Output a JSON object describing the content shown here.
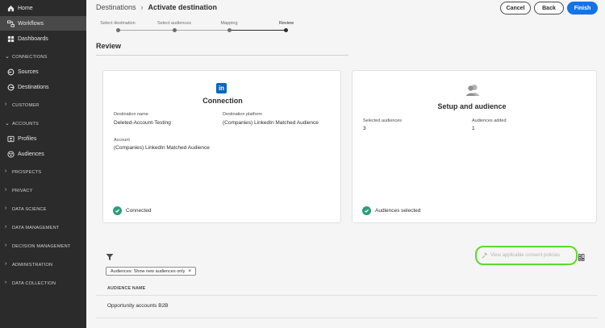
{
  "sidebar": {
    "top_items": [
      {
        "label": "Home",
        "icon": "home-icon"
      },
      {
        "label": "Workflows",
        "icon": "workflows-icon"
      },
      {
        "label": "Dashboards",
        "icon": "dashboards-icon"
      }
    ],
    "sections": {
      "connections": "CONNECTIONS",
      "customer": "CUSTOMER",
      "accounts": "ACCOUNTS",
      "prospects": "PROSPECTS",
      "privacy": "PRIVACY",
      "data_science": "DATA SCIENCE",
      "data_management": "DATA MANAGEMENT",
      "decision_management": "DECISION MANAGEMENT",
      "administration": "ADMINISTRATION",
      "data_collection": "DATA COLLECTION"
    },
    "connections_items": [
      {
        "label": "Sources",
        "icon": "sources-icon"
      },
      {
        "label": "Destinations",
        "icon": "destinations-icon"
      }
    ],
    "accounts_items": [
      {
        "label": "Profiles",
        "icon": "profiles-icon"
      },
      {
        "label": "Audiences",
        "icon": "audiences-icon"
      }
    ]
  },
  "header": {
    "breadcrumb_parent": "Destinations",
    "breadcrumb_separator": "›",
    "breadcrumb_current": "Activate destination",
    "cancel_label": "Cancel",
    "back_label": "Back",
    "finish_label": "Finish"
  },
  "steps": [
    {
      "label": "Select destination"
    },
    {
      "label": "Select audiences"
    },
    {
      "label": "Mapping"
    },
    {
      "label": "Review"
    }
  ],
  "review_title": "Review",
  "connection_card": {
    "logo_text": "in",
    "title": "Connection",
    "destination_name_label": "Destination name",
    "destination_name_value": "Deleted-Account-Testing",
    "destination_platform_label": "Destination platform",
    "destination_platform_value": "(Companies) LinkedIn Matched Audience",
    "account_label": "Account",
    "account_value": "(Companies) LinkedIn Matched Audience",
    "status": "Connected"
  },
  "setup_card": {
    "title": "Setup and audience",
    "selected_audiences_label": "Selected audiences",
    "selected_audiences_value": "3",
    "audiences_added_label": "Audiences added",
    "audiences_added_value": "1",
    "status": "Audiences selected"
  },
  "table": {
    "filter_tag": "Audiences: Show new audiences only",
    "filter_tag_close": "×",
    "consent_button": "View applicable consent policies",
    "column_header": "AUDIENCE NAME",
    "rows": [
      {
        "name": "Opportunity accounts B2B"
      }
    ]
  },
  "colors": {
    "sidebar_bg": "#2b2b2b",
    "accent_blue": "#1473e6",
    "success_green": "#2d9d78",
    "highlight_green": "#5cdc29",
    "linkedin_blue": "#0a66c2"
  }
}
